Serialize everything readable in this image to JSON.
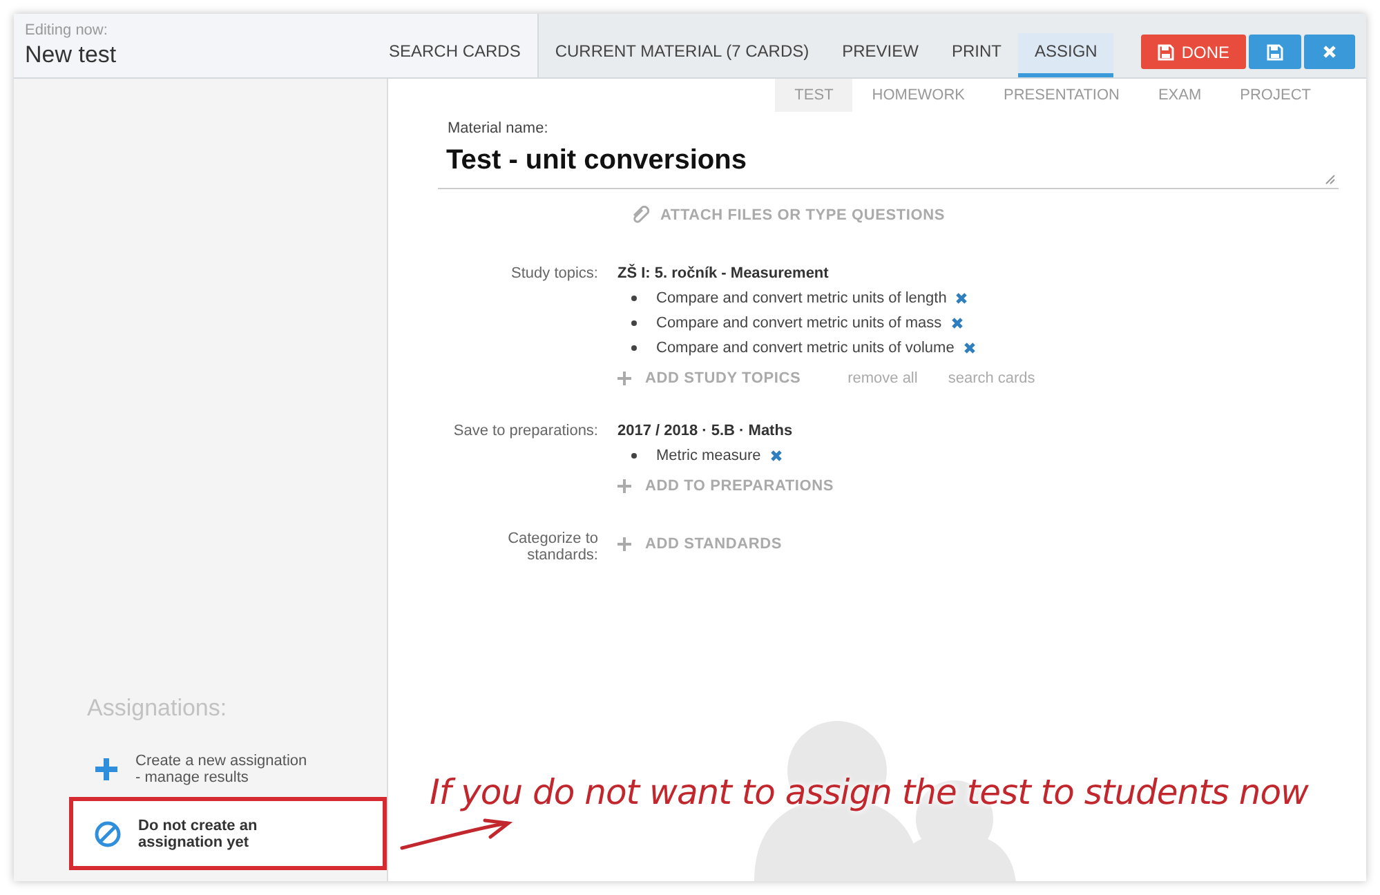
{
  "header": {
    "caption": "Editing now:",
    "title": "New test"
  },
  "nav_tabs": [
    {
      "label": "SEARCH CARDS",
      "selected": false
    },
    {
      "label": "CURRENT MATERIAL (7 CARDS)",
      "selected": false
    },
    {
      "label": "PREVIEW",
      "selected": false
    },
    {
      "label": "PRINT",
      "selected": false
    },
    {
      "label": "ASSIGN",
      "selected": true
    }
  ],
  "actions": [
    {
      "kind": "done",
      "label": "DONE"
    },
    {
      "kind": "save"
    },
    {
      "kind": "close"
    }
  ],
  "type_tabs": [
    {
      "label": "TEST",
      "selected": true
    },
    {
      "label": "HOMEWORK",
      "selected": false
    },
    {
      "label": "PRESENTATION",
      "selected": false
    },
    {
      "label": "EXAM",
      "selected": false
    },
    {
      "label": "PROJECT",
      "selected": false
    }
  ],
  "material": {
    "label": "Material name:",
    "value": "Test - unit conversions"
  },
  "attach": "ATTACH FILES OR TYPE QUESTIONS",
  "fields": [
    {
      "label": "Study topics:",
      "heading": "ZŠ I: 5. ročník - Measurement",
      "items": [
        "Compare and convert metric units of length",
        "Compare and convert metric units of mass",
        "Compare and convert metric units of volume"
      ],
      "add": "ADD STUDY TOPICS",
      "links": [
        "remove all",
        "search cards"
      ]
    },
    {
      "label": "Save to preparations:",
      "heading": "2017 / 2018 · 5.B · Maths",
      "items": [
        "Metric measure"
      ],
      "add": "ADD TO PREPARATIONS"
    },
    {
      "label": "Categorize to standards:",
      "add": "ADD STANDARDS"
    }
  ],
  "assignations": {
    "title": "Assignations:",
    "options": [
      {
        "kind": "create",
        "label": "Create a new assignation\n- manage results",
        "selected": false
      },
      {
        "kind": "none",
        "label": "Do not create an\nassignation yet",
        "selected": true
      }
    ]
  },
  "annotation": "If you do not want to assign the test to students now"
}
